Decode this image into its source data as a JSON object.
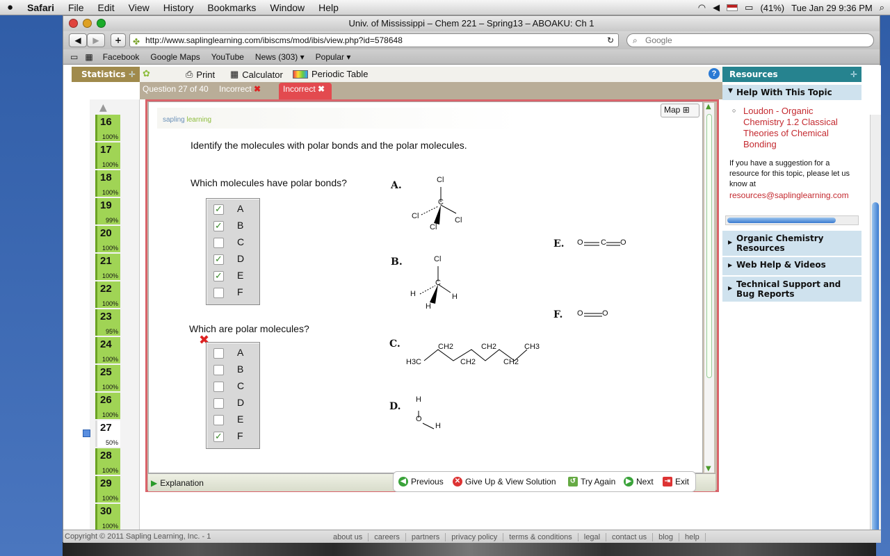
{
  "menubar": {
    "apple": "",
    "app": "Safari",
    "items": [
      "File",
      "Edit",
      "View",
      "History",
      "Bookmarks",
      "Window",
      "Help"
    ],
    "battery": "(41%)",
    "clock": "Tue Jan 29  9:36 PM"
  },
  "window": {
    "title": "Univ. of Mississippi – Chem 221 – Spring13 – ABOAKU: Ch 1"
  },
  "toolbar": {
    "back": "◀",
    "forward": "▶",
    "add": "+",
    "url": "http://www.saplinglearning.com/ibiscms/mod/ibis/view.php?id=578648",
    "search_placeholder": "Google"
  },
  "bookmarks": [
    "Facebook",
    "Google Maps",
    "YouTube",
    "News (303) ▾",
    "Popular ▾"
  ],
  "sapling": {
    "statistics": "Statistics",
    "tools": [
      "Print",
      "Calculator",
      "Periodic Table"
    ],
    "question_label": "Question 27 of 40",
    "status1": "Incorrect",
    "status2": "Incorrect",
    "map": "Map",
    "logo": {
      "a": "sapling",
      "b": "learning"
    },
    "prompt": "Identify the molecules with polar bonds and the polar molecules.",
    "q1": "Which molecules have polar bonds?",
    "q2": "Which are polar molecules?",
    "options": [
      "A",
      "B",
      "C",
      "D",
      "E",
      "F"
    ],
    "q1_checked": [
      true,
      true,
      false,
      true,
      true,
      false
    ],
    "q2_checked": [
      false,
      false,
      false,
      false,
      false,
      true
    ],
    "molecules": {
      "A": {
        "letter": "A.",
        "atoms": [
          "Cl",
          "C",
          "Cl",
          "Cl",
          "Cl"
        ]
      },
      "B": {
        "letter": "B.",
        "atoms": [
          "Cl",
          "C",
          "H",
          "H",
          "H"
        ]
      },
      "C": {
        "letter": "C.",
        "atoms": [
          "H3C",
          "CH2",
          "CH2",
          "CH2",
          "CH2",
          "CH3"
        ]
      },
      "D": {
        "letter": "D.",
        "atoms": [
          "H",
          "O",
          "H"
        ]
      },
      "E": {
        "letter": "E.",
        "atoms": [
          "O",
          "C",
          "O"
        ]
      },
      "F": {
        "letter": "F.",
        "atoms": [
          "O",
          "O"
        ]
      }
    },
    "explanation": "Explanation",
    "nav": [
      "Previous",
      "Give Up & View Solution",
      "Try Again",
      "Next",
      "Exit"
    ],
    "questions": [
      {
        "n": "16",
        "p": "100%"
      },
      {
        "n": "17",
        "p": "100%"
      },
      {
        "n": "18",
        "p": "100%"
      },
      {
        "n": "19",
        "p": "99%"
      },
      {
        "n": "20",
        "p": "100%"
      },
      {
        "n": "21",
        "p": "100%"
      },
      {
        "n": "22",
        "p": "100%"
      },
      {
        "n": "23",
        "p": "95%"
      },
      {
        "n": "24",
        "p": "100%"
      },
      {
        "n": "25",
        "p": "100%"
      },
      {
        "n": "26",
        "p": "100%"
      },
      {
        "n": "27",
        "p": "50%"
      },
      {
        "n": "28",
        "p": "100%"
      },
      {
        "n": "29",
        "p": "100%"
      },
      {
        "n": "30",
        "p": "100%"
      }
    ],
    "current_question": "27"
  },
  "resources": {
    "title": "Resources",
    "help_topic": "Help With This Topic",
    "link": "Loudon - Organic Chemistry 1.2 Classical Theories of Chemical Bonding",
    "suggestion": "If you have a suggestion for a resource for this topic, please let us know at",
    "email": "resources@saplinglearning.com",
    "panels": [
      "Organic Chemistry Resources",
      "Web Help & Videos",
      "Technical Support and Bug Reports"
    ]
  },
  "footer": {
    "copyright": "Copyright © 2011 Sapling Learning, Inc. - 1",
    "links": [
      "about us",
      "careers",
      "partners",
      "privacy policy",
      "terms & conditions",
      "legal",
      "contact us",
      "blog",
      "help"
    ]
  },
  "colors": {
    "accent_teal": "#26838f",
    "incorrect_red": "#e34a4f",
    "progress_green": "#a0d455",
    "stats_tan": "#a08a4c"
  }
}
